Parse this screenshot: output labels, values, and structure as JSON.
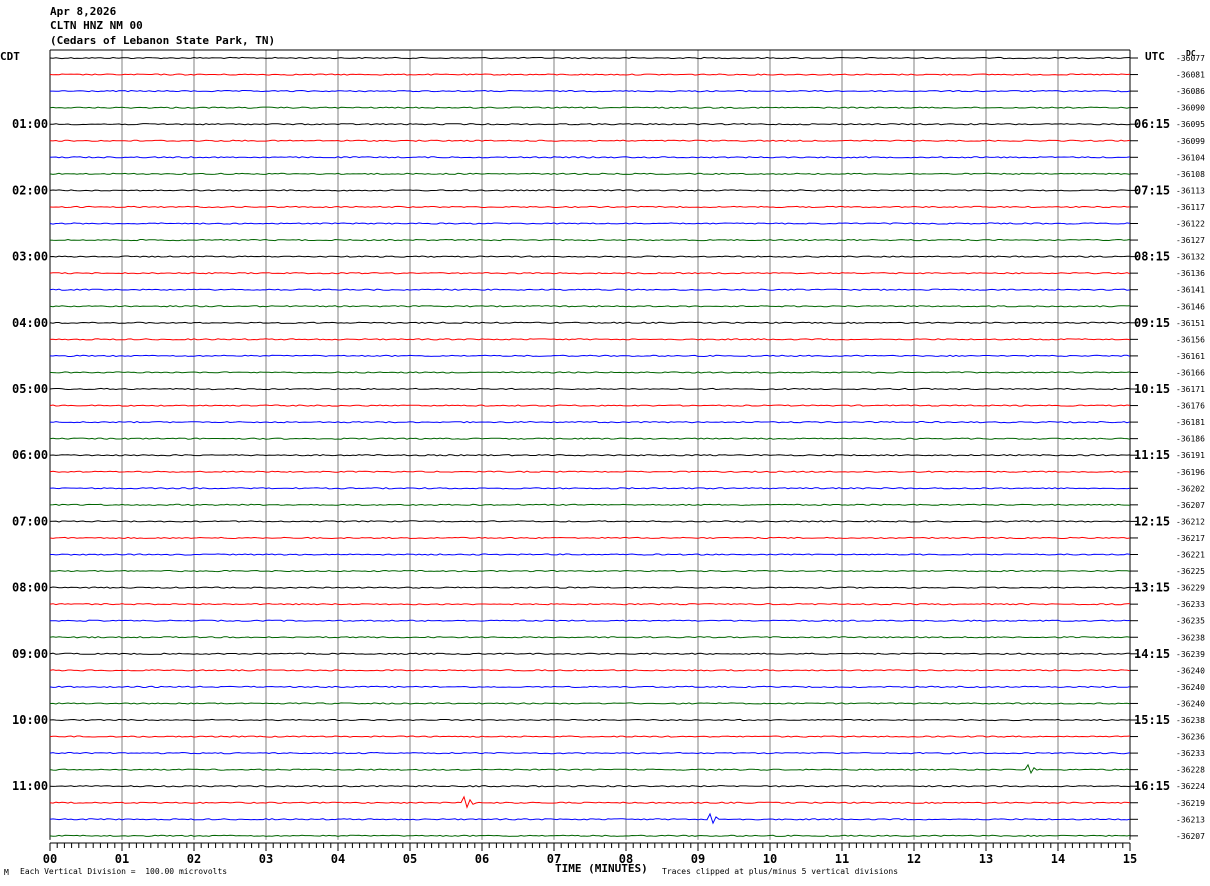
{
  "header": {
    "date": "Apr 8,2026",
    "station": "CLTN HNZ NM 00",
    "location": "(Cedars of Lebanon State Park, TN)"
  },
  "left_tz": "CDT",
  "right_tz": "UTC",
  "dc_label": "DC",
  "footer": {
    "scale_note": "Each Vertical Division =  100.00 microvolts",
    "clip_note": "Traces clipped at plus/minus 5 vertical divisions",
    "mark": "M"
  },
  "colors": {
    "black": "#000000",
    "red": "#ff0000",
    "blue": "#0000ff",
    "green": "#006400",
    "grid": "#808080"
  },
  "chart_data": {
    "type": "line",
    "title": "CLTN HNZ NM 00",
    "xlabel": "TIME (MINUTES)",
    "x_ticks": [
      "00",
      "01",
      "02",
      "03",
      "04",
      "05",
      "06",
      "07",
      "08",
      "09",
      "10",
      "11",
      "12",
      "13",
      "14",
      "15"
    ],
    "xlim": [
      0,
      15
    ],
    "trace_colors": [
      "black",
      "red",
      "blue",
      "green"
    ],
    "left_hour_labels": [
      "01:00",
      "02:00",
      "03:00",
      "04:00",
      "05:00",
      "06:00",
      "07:00",
      "08:00",
      "09:00",
      "10:00",
      "11:00"
    ],
    "right_hour_labels": [
      "06:15",
      "07:15",
      "08:15",
      "09:15",
      "10:15",
      "11:15",
      "12:15",
      "13:15",
      "14:15",
      "15:15",
      "16:15"
    ],
    "dc_offsets": [
      "-36077",
      "-36081",
      "-36086",
      "-36090",
      "-36095",
      "-36099",
      "-36104",
      "-36108",
      "-36113",
      "-36117",
      "-36122",
      "-36127",
      "-36132",
      "-36136",
      "-36141",
      "-36146",
      "-36151",
      "-36156",
      "-36161",
      "-36166",
      "-36171",
      "-36176",
      "-36181",
      "-36186",
      "-36191",
      "-36196",
      "-36202",
      "-36207",
      "-36212",
      "-36217",
      "-36221",
      "-36225",
      "-36229",
      "-36233",
      "-36235",
      "-36238",
      "-36239",
      "-36240",
      "-36240",
      "-36240",
      "-36238",
      "-36236",
      "-36233",
      "-36228",
      "-36224",
      "-36219",
      "-36213",
      "-36207"
    ],
    "events": [
      {
        "trace": 45,
        "minute": 5.75,
        "type": "spike"
      },
      {
        "trace": 46,
        "minute": 9.15,
        "type": "spike"
      },
      {
        "trace": 43,
        "minute": 13.55,
        "type": "spike"
      }
    ]
  }
}
